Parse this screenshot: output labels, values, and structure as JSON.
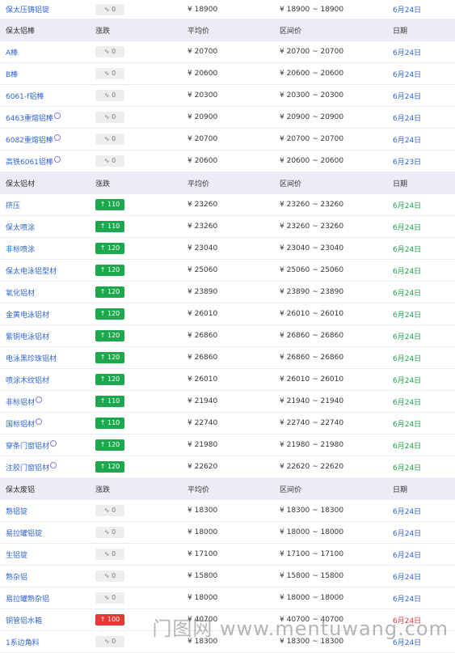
{
  "top_row": {
    "name": "保太压铸铝锭",
    "change": "∿ 0",
    "avg": "¥ 18900",
    "range": "¥ 18900 ~ 18900",
    "date": "6月24日"
  },
  "sections": [
    {
      "header": {
        "name": "保太铝棒",
        "change": "涨跌",
        "avg": "平均价",
        "range": "区间价",
        "date": "日期"
      },
      "rows": [
        {
          "name": "A棒",
          "change": "∿ 0",
          "dir": "flat",
          "avg": "¥ 20700",
          "range": "¥ 20700 ~ 20700",
          "date": "6月24日",
          "date_color": "blue"
        },
        {
          "name": "B棒",
          "change": "∿ 0",
          "dir": "flat",
          "avg": "¥ 20600",
          "range": "¥ 20600 ~ 20600",
          "date": "6月24日",
          "date_color": "blue"
        },
        {
          "name": "6061-f铝棒",
          "change": "∿ 0",
          "dir": "flat",
          "avg": "¥ 20300",
          "range": "¥ 20300 ~ 20300",
          "date": "6月24日",
          "date_color": "blue"
        },
        {
          "name": "6463重熔铝棒",
          "change": "∿ 0",
          "dir": "flat",
          "avg": "¥ 20900",
          "range": "¥ 20900 ~ 20900",
          "date": "6月24日",
          "date_color": "blue",
          "mark": true
        },
        {
          "name": "6082重熔铝棒",
          "change": "∿ 0",
          "dir": "flat",
          "avg": "¥ 20700",
          "range": "¥ 20700 ~ 20700",
          "date": "6月24日",
          "date_color": "blue",
          "mark": true
        },
        {
          "name": "高铁6061铝棒",
          "change": "∿ 0",
          "dir": "flat",
          "avg": "¥ 20600",
          "range": "¥ 20600 ~ 20600",
          "date": "6月23日",
          "date_color": "blue",
          "mark": true
        }
      ]
    },
    {
      "header": {
        "name": "保太铝材",
        "change": "涨跌",
        "avg": "平均价",
        "range": "区间价",
        "date": "日期"
      },
      "rows": [
        {
          "name": "挤压",
          "change": "↑ 110",
          "dir": "up",
          "avg": "¥ 23260",
          "range": "¥ 23260 ~ 23260",
          "date": "6月24日",
          "date_color": "green"
        },
        {
          "name": "保太喷涂",
          "change": "↑ 110",
          "dir": "up",
          "avg": "¥ 23260",
          "range": "¥ 23260 ~ 23260",
          "date": "6月24日",
          "date_color": "green"
        },
        {
          "name": "非标喷涂",
          "change": "↑ 120",
          "dir": "up",
          "avg": "¥ 23040",
          "range": "¥ 23040 ~ 23040",
          "date": "6月24日",
          "date_color": "green"
        },
        {
          "name": "保太电泳铝型材",
          "change": "↑ 120",
          "dir": "up",
          "avg": "¥ 25060",
          "range": "¥ 25060 ~ 25060",
          "date": "6月24日",
          "date_color": "green"
        },
        {
          "name": "氧化铝材",
          "change": "↑ 120",
          "dir": "up",
          "avg": "¥ 23890",
          "range": "¥ 23890 ~ 23890",
          "date": "6月24日",
          "date_color": "green"
        },
        {
          "name": "金黄电泳铝材",
          "change": "↑ 120",
          "dir": "up",
          "avg": "¥ 26010",
          "range": "¥ 26010 ~ 26010",
          "date": "6月24日",
          "date_color": "green"
        },
        {
          "name": "紫铜电泳铝材",
          "change": "↑ 120",
          "dir": "up",
          "avg": "¥ 26860",
          "range": "¥ 26860 ~ 26860",
          "date": "6月24日",
          "date_color": "green"
        },
        {
          "name": "电泳黑珍珠铝材",
          "change": "↑ 120",
          "dir": "up",
          "avg": "¥ 26860",
          "range": "¥ 26860 ~ 26860",
          "date": "6月24日",
          "date_color": "green"
        },
        {
          "name": "喷涂木纹铝材",
          "change": "↑ 120",
          "dir": "up",
          "avg": "¥ 26010",
          "range": "¥ 26010 ~ 26010",
          "date": "6月24日",
          "date_color": "green"
        },
        {
          "name": "非标铝材",
          "change": "↑ 110",
          "dir": "up",
          "avg": "¥ 21940",
          "range": "¥ 21940 ~ 21940",
          "date": "6月24日",
          "date_color": "green",
          "mark": true
        },
        {
          "name": "国标铝材",
          "change": "↑ 110",
          "dir": "up",
          "avg": "¥ 22740",
          "range": "¥ 22740 ~ 22740",
          "date": "6月24日",
          "date_color": "green",
          "mark": true
        },
        {
          "name": "穿条门窗铝材",
          "change": "↑ 120",
          "dir": "up",
          "avg": "¥ 21980",
          "range": "¥ 21980 ~ 21980",
          "date": "6月24日",
          "date_color": "green",
          "mark": true
        },
        {
          "name": "注胶门窗铝材",
          "change": "↑ 120",
          "dir": "up",
          "avg": "¥ 22620",
          "range": "¥ 22620 ~ 22620",
          "date": "6月24日",
          "date_color": "green",
          "mark": true
        }
      ]
    },
    {
      "header": {
        "name": "保太废铝",
        "change": "涨跌",
        "avg": "平均价",
        "range": "区间价",
        "date": "日期"
      },
      "rows": [
        {
          "name": "熟铝锭",
          "change": "∿ 0",
          "dir": "flat",
          "avg": "¥ 18300",
          "range": "¥ 18300 ~ 18300",
          "date": "6月24日",
          "date_color": "blue"
        },
        {
          "name": "易拉罐铝锭",
          "change": "∿ 0",
          "dir": "flat",
          "avg": "¥ 18000",
          "range": "¥ 18000 ~ 18000",
          "date": "6月24日",
          "date_color": "blue"
        },
        {
          "name": "生铝锭",
          "change": "∿ 0",
          "dir": "flat",
          "avg": "¥ 17100",
          "range": "¥ 17100 ~ 17100",
          "date": "6月24日",
          "date_color": "blue"
        },
        {
          "name": "熟杂铝",
          "change": "∿ 0",
          "dir": "flat",
          "avg": "¥ 15800",
          "range": "¥ 15800 ~ 15800",
          "date": "6月24日",
          "date_color": "blue"
        },
        {
          "name": "易拉罐熟杂铝",
          "change": "∿ 0",
          "dir": "flat",
          "avg": "¥ 18000",
          "range": "¥ 18000 ~ 18000",
          "date": "6月24日",
          "date_color": "blue"
        },
        {
          "name": "铜管铝水箱",
          "change": "↑ 100",
          "dir": "red",
          "avg": "¥ 40700",
          "range": "¥ 40700 ~ 40700",
          "date": "6月24日",
          "date_color": "red"
        },
        {
          "name": "1系边角料",
          "change": "∿ 0",
          "dir": "flat",
          "avg": "¥ 18300",
          "range": "¥ 18300 ~ 18300",
          "date": "6月24日",
          "date_color": "blue"
        }
      ]
    }
  ],
  "watermark": "门图网 www.mentuwang.com"
}
